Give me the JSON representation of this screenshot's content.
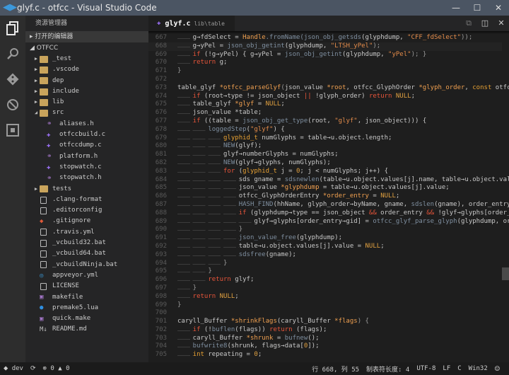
{
  "window": {
    "title": "glyf.c - otfcc - Visual Studio Code"
  },
  "sidebar": {
    "title": "资源管理器",
    "open_editors": "打开的编辑器",
    "project": "OTFCC",
    "items": [
      {
        "name": "_test",
        "type": "folder",
        "depth": 1,
        "state": "closed"
      },
      {
        "name": ".vscode",
        "type": "folder",
        "depth": 1,
        "state": "closed"
      },
      {
        "name": "dep",
        "type": "folder",
        "depth": 1,
        "state": "closed"
      },
      {
        "name": "include",
        "type": "folder",
        "depth": 1,
        "state": "closed"
      },
      {
        "name": "lib",
        "type": "folder",
        "depth": 1,
        "state": "closed"
      },
      {
        "name": "src",
        "type": "folder",
        "depth": 1,
        "state": "open"
      },
      {
        "name": "aliases.h",
        "type": "h",
        "depth": 2
      },
      {
        "name": "otfccbuild.c",
        "type": "c",
        "depth": 2
      },
      {
        "name": "otfccdump.c",
        "type": "c",
        "depth": 2
      },
      {
        "name": "platform.h",
        "type": "h",
        "depth": 2
      },
      {
        "name": "stopwatch.c",
        "type": "c",
        "depth": 2
      },
      {
        "name": "stopwatch.h",
        "type": "h",
        "depth": 2
      },
      {
        "name": "tests",
        "type": "folder",
        "depth": 1,
        "state": "closed"
      },
      {
        "name": ".clang-format",
        "type": "file",
        "depth": 1
      },
      {
        "name": ".editorconfig",
        "type": "file",
        "depth": 1
      },
      {
        "name": ".gitignore",
        "type": "git",
        "depth": 1
      },
      {
        "name": ".travis.yml",
        "type": "file",
        "depth": 1
      },
      {
        "name": "_vcbuild32.bat",
        "type": "file",
        "depth": 1
      },
      {
        "name": "_vcbuild64.bat",
        "type": "file",
        "depth": 1
      },
      {
        "name": "_vcbuildNinja.bat",
        "type": "file",
        "depth": 1
      },
      {
        "name": "appveyor.yml",
        "type": "appveyor",
        "depth": 1
      },
      {
        "name": "LICENSE",
        "type": "file",
        "depth": 1
      },
      {
        "name": "makefile",
        "type": "make",
        "depth": 1
      },
      {
        "name": "premake5.lua",
        "type": "lua",
        "depth": 1
      },
      {
        "name": "quick.make",
        "type": "make",
        "depth": 1
      },
      {
        "name": "README.md",
        "type": "md",
        "depth": 1
      }
    ]
  },
  "tab": {
    "name": "glyf.c",
    "path": "lib\\table"
  },
  "editor": {
    "current_line": 668,
    "lines": [
      {
        "n": 667,
        "i": 1,
        "t": [
          [
            "d",
            "g→fdSelect = "
          ],
          [
            "v",
            "Handle"
          ],
          [
            "f",
            ".fromName("
          ],
          [
            "f",
            "json_obj_getsds"
          ],
          [
            "d",
            "(glyphdump, "
          ],
          [
            "s",
            "\"CFF_fdSelect\""
          ],
          [
            "p",
            "));"
          ]
        ]
      },
      {
        "n": 668,
        "i": 1,
        "t": [
          [
            "d",
            "g→yPel = "
          ],
          [
            "f",
            "json_obj_getint"
          ],
          [
            "d",
            "(glyphdump, "
          ],
          [
            "s",
            "\"LTSH_yPel\""
          ],
          [
            "p",
            ");"
          ]
        ]
      },
      {
        "n": 669,
        "i": 1,
        "t": [
          [
            "k",
            "if"
          ],
          [
            "d",
            " (!g→yPel) { g→yPel = "
          ],
          [
            "f",
            "json_obj_getint"
          ],
          [
            "d",
            "(glyphdump, "
          ],
          [
            "s",
            "\"yPel\""
          ],
          [
            "p",
            "); }"
          ]
        ]
      },
      {
        "n": 670,
        "i": 1,
        "t": [
          [
            "k",
            "return"
          ],
          [
            "d",
            " g;"
          ]
        ]
      },
      {
        "n": 671,
        "i": 0,
        "t": [
          [
            "p",
            "}"
          ]
        ]
      },
      {
        "n": 672,
        "i": 0,
        "t": []
      },
      {
        "n": 673,
        "i": 0,
        "t": [
          [
            "d",
            "table_glyf "
          ],
          [
            "v",
            "*otfcc_parseGlyf"
          ],
          [
            "p",
            "("
          ],
          [
            "d",
            "json_value "
          ],
          [
            "v",
            "*root"
          ],
          [
            "d",
            ", otfcc_GlyphOrder "
          ],
          [
            "v",
            "*glyph_order"
          ],
          [
            "d",
            ", "
          ],
          [
            "t",
            "const"
          ],
          [
            "d",
            " otfcc_Options "
          ],
          [
            "v",
            "*options"
          ],
          [
            "p",
            ") {"
          ]
        ]
      },
      {
        "n": 674,
        "i": 1,
        "t": [
          [
            "k",
            "if"
          ],
          [
            "d",
            " (root→type != json_object "
          ],
          [
            "k",
            "||"
          ],
          [
            "d",
            " !glyph_order) "
          ],
          [
            "k",
            "return"
          ],
          [
            "m",
            " NULL"
          ],
          [
            "d",
            ";"
          ]
        ]
      },
      {
        "n": 675,
        "i": 1,
        "t": [
          [
            "d",
            "table_glyf "
          ],
          [
            "v",
            "*glyf"
          ],
          [
            "d",
            " = "
          ],
          [
            "m",
            "NULL"
          ],
          [
            "d",
            ";"
          ]
        ]
      },
      {
        "n": 676,
        "i": 1,
        "t": [
          [
            "d",
            "json_value *table;"
          ]
        ]
      },
      {
        "n": 677,
        "i": 1,
        "t": [
          [
            "k",
            "if"
          ],
          [
            "d",
            " ((table = "
          ],
          [
            "f",
            "json_obj_get_type"
          ],
          [
            "d",
            "(root, "
          ],
          [
            "s",
            "\"glyf\""
          ],
          [
            "d",
            ", json_object))) {"
          ]
        ]
      },
      {
        "n": 678,
        "i": 2,
        "t": [
          [
            "f",
            "loggedStep"
          ],
          [
            "d",
            "("
          ],
          [
            "s",
            "\"glyf\""
          ],
          [
            "d",
            ") {"
          ]
        ]
      },
      {
        "n": 679,
        "i": 3,
        "t": [
          [
            "t",
            "glyphid_t"
          ],
          [
            "d",
            " numGlyphs = table→u.object.length;"
          ]
        ]
      },
      {
        "n": 680,
        "i": 3,
        "t": [
          [
            "f",
            "NEW"
          ],
          [
            "d",
            "(glyf);"
          ]
        ]
      },
      {
        "n": 681,
        "i": 3,
        "t": [
          [
            "d",
            "glyf→numberGlyphs = numGlyphs;"
          ]
        ]
      },
      {
        "n": 682,
        "i": 3,
        "t": [
          [
            "f",
            "NEW"
          ],
          [
            "d",
            "(glyf→glyphs, numGlyphs);"
          ]
        ]
      },
      {
        "n": 683,
        "i": 3,
        "t": [
          [
            "k",
            "for"
          ],
          [
            "d",
            " ("
          ],
          [
            "t",
            "glyphid_t"
          ],
          [
            "d",
            " j = "
          ],
          [
            "m",
            "0"
          ],
          [
            "d",
            "; j < numGlyphs; j++) {"
          ]
        ]
      },
      {
        "n": 684,
        "i": 4,
        "t": [
          [
            "d",
            "sds gname = "
          ],
          [
            "f",
            "sdsnewlen"
          ],
          [
            "d",
            "(table→u.object.values[j].name, table→u.object.values[j].name_length);"
          ]
        ]
      },
      {
        "n": 685,
        "i": 4,
        "t": [
          [
            "d",
            "json_value "
          ],
          [
            "v",
            "*glyphdump"
          ],
          [
            "d",
            " = table→u.object.values[j].value;"
          ]
        ]
      },
      {
        "n": 686,
        "i": 4,
        "t": [
          [
            "d",
            "otfcc_GlyphOrderEntry "
          ],
          [
            "v",
            "*order_entry"
          ],
          [
            "d",
            " = "
          ],
          [
            "m",
            "NULL"
          ],
          [
            "d",
            ";"
          ]
        ]
      },
      {
        "n": 687,
        "i": 4,
        "t": [
          [
            "f",
            "HASH_FIND"
          ],
          [
            "d",
            "(hhName, glyph_order→byName, gname, "
          ],
          [
            "f",
            "sdslen"
          ],
          [
            "d",
            "(gname), order_entry);"
          ]
        ]
      },
      {
        "n": 688,
        "i": 4,
        "t": [
          [
            "k",
            "if"
          ],
          [
            "d",
            " (glyphdump→type == json_object "
          ],
          [
            "k",
            "&&"
          ],
          [
            "d",
            " order_entry "
          ],
          [
            "k",
            "&&"
          ],
          [
            "d",
            " !glyf→glyphs[order_entry→gid]) {"
          ]
        ]
      },
      {
        "n": 689,
        "i": 5,
        "t": [
          [
            "d",
            "glyf→glyphs[order_entry→gid] = "
          ],
          [
            "f",
            "otfcc_glyf_parse_glyph"
          ],
          [
            "d",
            "(glyphdump, order_entry, options);"
          ]
        ]
      },
      {
        "n": 690,
        "i": 4,
        "t": [
          [
            "p",
            "}"
          ]
        ]
      },
      {
        "n": 691,
        "i": 4,
        "t": [
          [
            "f",
            "json_value_free"
          ],
          [
            "d",
            "(glyphdump);"
          ]
        ]
      },
      {
        "n": 692,
        "i": 4,
        "t": [
          [
            "d",
            "table→u.object.values[j].value = "
          ],
          [
            "m",
            "NULL"
          ],
          [
            "d",
            ";"
          ]
        ]
      },
      {
        "n": 693,
        "i": 4,
        "t": [
          [
            "f",
            "sdsfree"
          ],
          [
            "d",
            "(gname);"
          ]
        ]
      },
      {
        "n": 694,
        "i": 3,
        "t": [
          [
            "p",
            "}"
          ]
        ]
      },
      {
        "n": 695,
        "i": 2,
        "t": [
          [
            "p",
            "}"
          ]
        ]
      },
      {
        "n": 696,
        "i": 2,
        "t": [
          [
            "k",
            "return"
          ],
          [
            "d",
            " glyf;"
          ]
        ]
      },
      {
        "n": 697,
        "i": 1,
        "t": [
          [
            "p",
            "}"
          ]
        ]
      },
      {
        "n": 698,
        "i": 1,
        "t": [
          [
            "k",
            "return"
          ],
          [
            "m",
            " NULL"
          ],
          [
            "d",
            ";"
          ]
        ]
      },
      {
        "n": 699,
        "i": 0,
        "t": [
          [
            "p",
            "}"
          ]
        ]
      },
      {
        "n": 700,
        "i": 0,
        "t": []
      },
      {
        "n": 701,
        "i": 0,
        "t": [
          [
            "d",
            "caryll_Buffer "
          ],
          [
            "v",
            "*shrinkFlags"
          ],
          [
            "d",
            "(caryll_Buffer "
          ],
          [
            "v",
            "*flags"
          ],
          [
            "p",
            ") {"
          ]
        ]
      },
      {
        "n": 702,
        "i": 1,
        "t": [
          [
            "k",
            "if"
          ],
          [
            "d",
            " (!"
          ],
          [
            "f",
            "buflen"
          ],
          [
            "d",
            "(flags)) "
          ],
          [
            "k",
            "return"
          ],
          [
            "d",
            " (flags);"
          ]
        ]
      },
      {
        "n": 703,
        "i": 1,
        "t": [
          [
            "d",
            "caryll_Buffer "
          ],
          [
            "v",
            "*shrunk"
          ],
          [
            "d",
            " = "
          ],
          [
            "f",
            "bufnew"
          ],
          [
            "d",
            "();"
          ]
        ]
      },
      {
        "n": 704,
        "i": 1,
        "t": [
          [
            "f",
            "bufwrite8"
          ],
          [
            "d",
            "(shrunk, flags→data["
          ],
          [
            "m",
            "0"
          ],
          [
            "d",
            "]);"
          ]
        ]
      },
      {
        "n": 705,
        "i": 1,
        "t": [
          [
            "t",
            "int"
          ],
          [
            "d",
            " repeating = "
          ],
          [
            "m",
            "0"
          ],
          [
            "d",
            ";"
          ]
        ]
      }
    ]
  },
  "status": {
    "branch": "dev",
    "errors": "0",
    "warnings": "0",
    "position": "行 668, 列 55",
    "tab_size": "制表符长度: 4",
    "encoding": "UTF-8",
    "eol": "LF",
    "language": "C",
    "platform": "Win32"
  }
}
